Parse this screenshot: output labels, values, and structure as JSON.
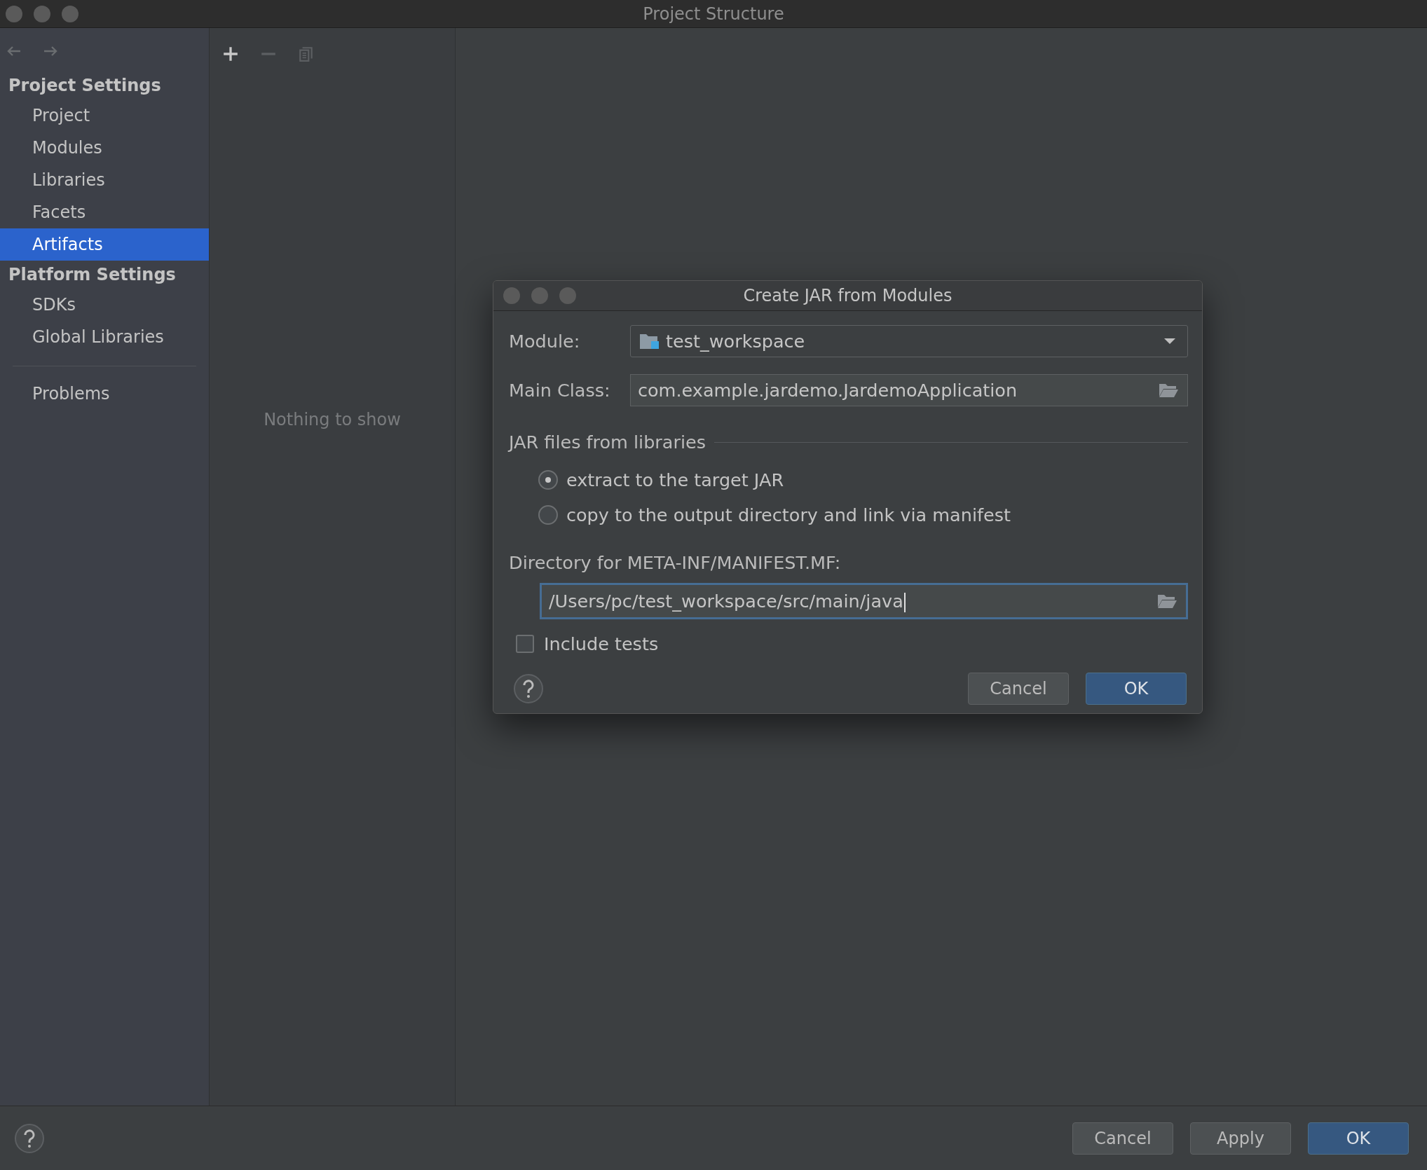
{
  "window": {
    "title": "Project Structure"
  },
  "nav": [
    {
      "kind": "back",
      "disabled": true
    },
    {
      "kind": "forward",
      "disabled": true
    }
  ],
  "sidebar": {
    "sections": [
      {
        "title": "Project Settings",
        "items": [
          {
            "label": "Project",
            "selected": false
          },
          {
            "label": "Modules",
            "selected": false
          },
          {
            "label": "Libraries",
            "selected": false
          },
          {
            "label": "Facets",
            "selected": false
          },
          {
            "label": "Artifacts",
            "selected": true
          }
        ]
      },
      {
        "title": "Platform Settings",
        "items": [
          {
            "label": "SDKs",
            "selected": false
          },
          {
            "label": "Global Libraries",
            "selected": false
          }
        ]
      }
    ],
    "extra_items": [
      {
        "label": "Problems",
        "selected": false
      }
    ]
  },
  "toolbar": [
    {
      "kind": "add",
      "disabled": false
    },
    {
      "kind": "remove",
      "disabled": true
    },
    {
      "kind": "copy",
      "disabled": true
    }
  ],
  "empty_text": "Nothing to show",
  "dialog": {
    "title": "Create JAR from Modules",
    "module": {
      "label": "Module:",
      "value": "test_workspace"
    },
    "main_class": {
      "label": "Main Class:",
      "value": "com.example.jardemo.JardemoApplication",
      "focused": false
    },
    "jar_group": {
      "title": "JAR files from libraries",
      "options": [
        {
          "label": "extract to the target JAR",
          "selected": true
        },
        {
          "label": "copy to the output directory and link via manifest",
          "selected": false
        }
      ]
    },
    "manifest_dir": {
      "label": "Directory for META-INF/MANIFEST.MF:",
      "value": "/Users/pc/test_workspace/src/main/java",
      "focused": true
    },
    "include_tests": {
      "label": "Include tests",
      "checked": false
    },
    "buttons": [
      {
        "label": "Cancel",
        "primary": false
      },
      {
        "label": "OK",
        "primary": true
      }
    ]
  },
  "footer_buttons": [
    {
      "label": "Cancel",
      "primary": false
    },
    {
      "label": "Apply",
      "primary": false
    },
    {
      "label": "OK",
      "primary": true
    }
  ]
}
